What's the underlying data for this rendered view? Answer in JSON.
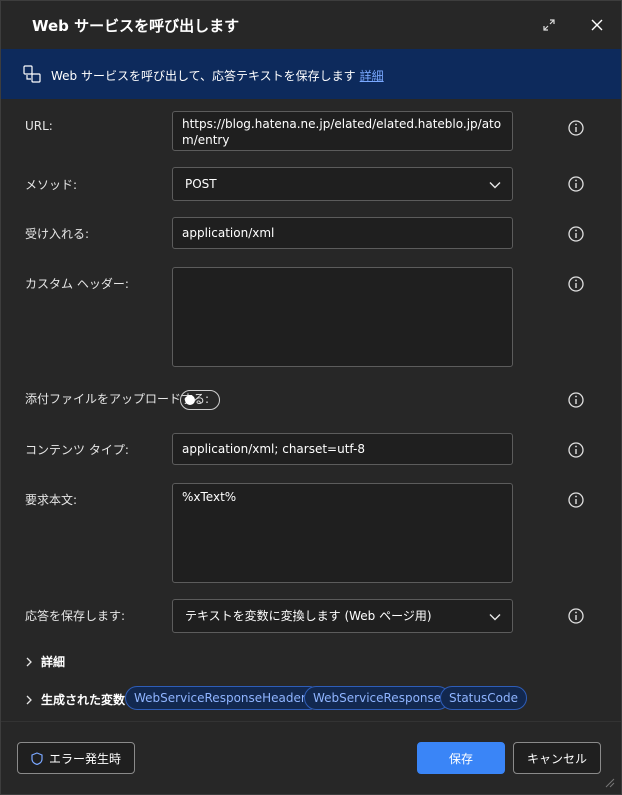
{
  "dialog": {
    "title": "Web サービスを呼び出します",
    "banner_text": "Web サービスを呼び出して、応答テキストを保存します",
    "banner_link": "詳細"
  },
  "form": {
    "url": {
      "label": "URL:",
      "value": "https://blog.hatena.ne.jp/elated/elated.hateblo.jp/atom/entry"
    },
    "method": {
      "label": "メソッド:",
      "value": "POST"
    },
    "accept": {
      "label": "受け入れる:",
      "value": "application/xml"
    },
    "custom_headers": {
      "label": "カスタム ヘッダー:",
      "value": ""
    },
    "attach_file": {
      "label": "添付ファイルをアップロードする:",
      "on": false
    },
    "content_type": {
      "label": "コンテンツ タイプ:",
      "value": "application/xml; charset=utf-8"
    },
    "request_body": {
      "label": "要求本文:",
      "value": "%xText%"
    },
    "save_response": {
      "label": "応答を保存します:",
      "value": "テキストを変数に変換します (Web ページ用)"
    }
  },
  "sections": {
    "advanced": "詳細",
    "generated_vars": "生成された変数"
  },
  "variables": [
    "WebServiceResponseHeaders",
    "WebServiceResponse",
    "StatusCode"
  ],
  "footer": {
    "on_error": "エラー発生時",
    "save": "保存",
    "cancel": "キャンセル"
  },
  "colors": {
    "accent": "#3a85f7",
    "banner_bg": "#0d2a5c",
    "chip_border": "#2e5db8"
  },
  "icons": {
    "expand": "expand-icon",
    "close": "close-icon",
    "banner": "web-service-icon",
    "info": "info-icon",
    "chevron_down": "chevron-down-icon",
    "chevron_right": "chevron-right-icon",
    "shield": "shield-icon"
  }
}
